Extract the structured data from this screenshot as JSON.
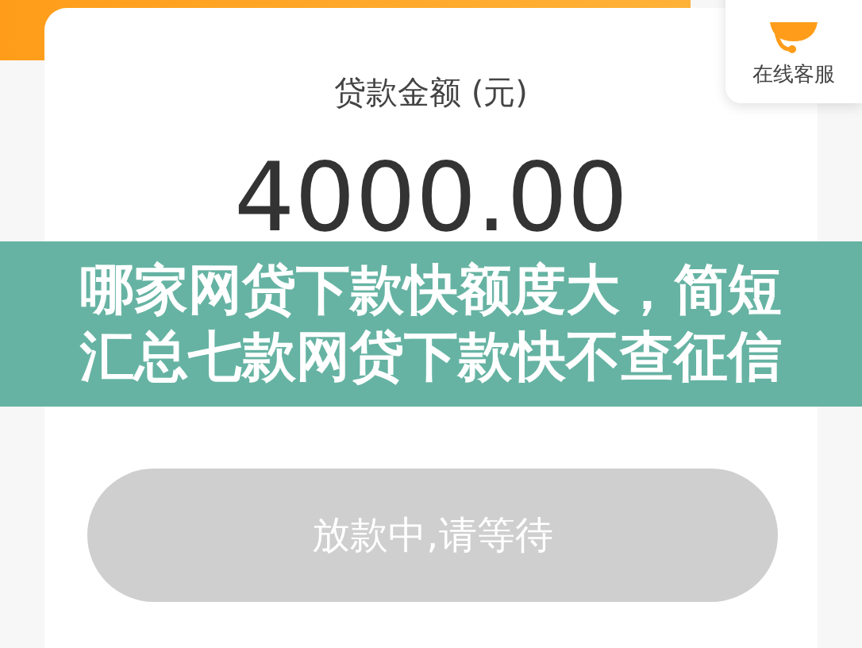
{
  "customer_service": {
    "label": "在线客服"
  },
  "loan": {
    "label": "贷款金额 (元)",
    "amount": "4000.00"
  },
  "banner": {
    "lines": [
      "哪家网贷下款快额度大，简短",
      "汇总七款网贷下款快不查征信"
    ]
  },
  "action_button": {
    "label": "放款中,请等待",
    "disabled": true
  }
}
